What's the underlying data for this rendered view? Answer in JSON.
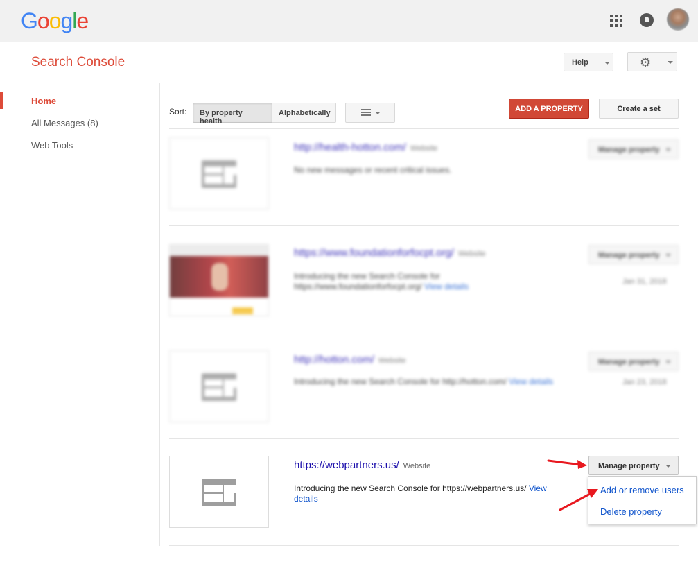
{
  "google_logo": [
    "G",
    "o",
    "o",
    "g",
    "l",
    "e"
  ],
  "logo_colors": [
    "#4285F4",
    "#EA4335",
    "#FBBC05",
    "#4285F4",
    "#34A853",
    "#EA4335"
  ],
  "header": {
    "title": "Search Console",
    "help_label": "Help"
  },
  "sidebar": {
    "items": [
      {
        "label": "Home",
        "active": true
      },
      {
        "label": "All Messages (8)",
        "active": false
      },
      {
        "label": "Web Tools",
        "active": false
      }
    ]
  },
  "toolbar": {
    "sort_label": "Sort:",
    "sort_by_health": "By property health",
    "sort_alpha": "Alphabetically",
    "add_property": "ADD A PROPERTY",
    "create_set": "Create a set"
  },
  "properties": [
    {
      "url": "http://health-hotton.com/",
      "type": "Website",
      "message": "No new messages or recent critical issues.",
      "link": "",
      "date": "",
      "manage": "Manage property"
    },
    {
      "url": "https://www.foundationforfocpt.org/",
      "type": "Website",
      "message": "Introducing the new Search Console for https://www.foundationforfocpt.org/",
      "link": "View details",
      "date": "Jan 31, 2018",
      "manage": "Manage property"
    },
    {
      "url": "http://hotton.com/",
      "type": "Website",
      "message": "Introducing the new Search Console for http://hotton.com/",
      "link": "View details",
      "date": "Jan 23, 2018",
      "manage": "Manage property"
    },
    {
      "url": "https://webpartners.us/",
      "type": "Website",
      "message": "Introducing the new Search Console for https://webpartners.us/",
      "link": "View details",
      "date": "",
      "manage": "Manage property"
    }
  ],
  "manage_menu": {
    "add_users": "Add or remove users",
    "delete": "Delete property"
  },
  "annotation_color": "#e8181f"
}
